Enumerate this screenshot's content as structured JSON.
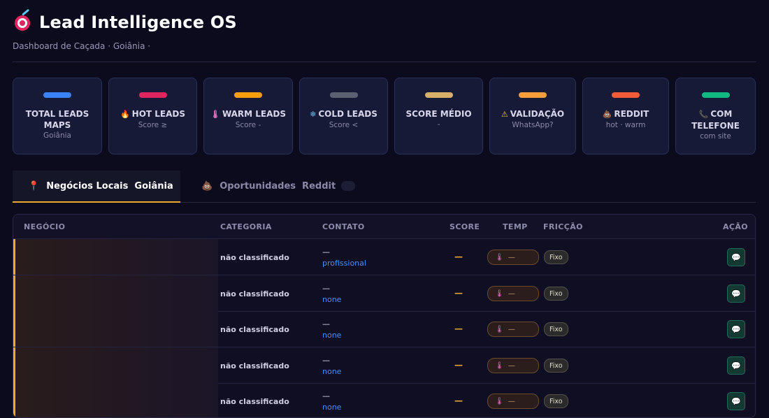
{
  "app": {
    "title": "Lead Intelligence OS",
    "subtitle": "Dashboard de Caçada · Goiânia ·"
  },
  "cards": [
    {
      "label": "TOTAL LEADS MAPS",
      "sub": "Goiânia",
      "color": "#3b82f6",
      "icon": ""
    },
    {
      "label": "HOT LEADS",
      "sub": "Score ≥",
      "color": "#e0245e",
      "icon": "🔥"
    },
    {
      "label": "WARM LEADS",
      "sub": "Score -",
      "color": "#f59e0b",
      "icon": "🌡"
    },
    {
      "label": "COLD LEADS",
      "sub": "Score <",
      "color": "#5b6170",
      "icon": "❄"
    },
    {
      "label": "SCORE MÉDIO",
      "sub": "-",
      "color": "#d6b06a",
      "icon": ""
    },
    {
      "label": "VALIDAÇÃO",
      "sub": "WhatsApp?",
      "color": "#f59e3b",
      "icon": "⚠"
    },
    {
      "label": "REDDIT",
      "sub": "hot · warm",
      "color": "#f25a3a",
      "icon": "💩"
    },
    {
      "label": "COM TELEFONE",
      "sub": "com site",
      "color": "#10b981",
      "icon": "📞"
    }
  ],
  "tabs": {
    "local": {
      "label": "Negócios Locais  Goiânia",
      "icon": "📍"
    },
    "reddit": {
      "label": "Oportunidades  Reddit",
      "icon": "💩"
    }
  },
  "table": {
    "headers": {
      "business": "NEGÓCIO",
      "category": "CATEGORIA",
      "contact": "CONTATO",
      "score": "SCORE",
      "temp": "TEMP",
      "friction": "FRICÇÃO",
      "action": "AÇÃO"
    },
    "rows": [
      {
        "category": "não classificado",
        "contact": "—",
        "contact_link": "profissional",
        "score": "—",
        "temp": "—",
        "friction": "Fixo"
      },
      {
        "category": "não classificado",
        "contact": "—",
        "contact_link": "none",
        "score": "—",
        "temp": "—",
        "friction": "Fixo"
      },
      {
        "category": "não classificado",
        "contact": "—",
        "contact_link": "none",
        "score": "—",
        "temp": "—",
        "friction": "Fixo"
      },
      {
        "category": "não classificado",
        "contact": "—",
        "contact_link": "none",
        "score": "—",
        "temp": "—",
        "friction": "Fixo"
      },
      {
        "category": "não classificado",
        "contact": "—",
        "contact_link": "none",
        "score": "—",
        "temp": "—",
        "friction": "Fixo"
      }
    ]
  }
}
